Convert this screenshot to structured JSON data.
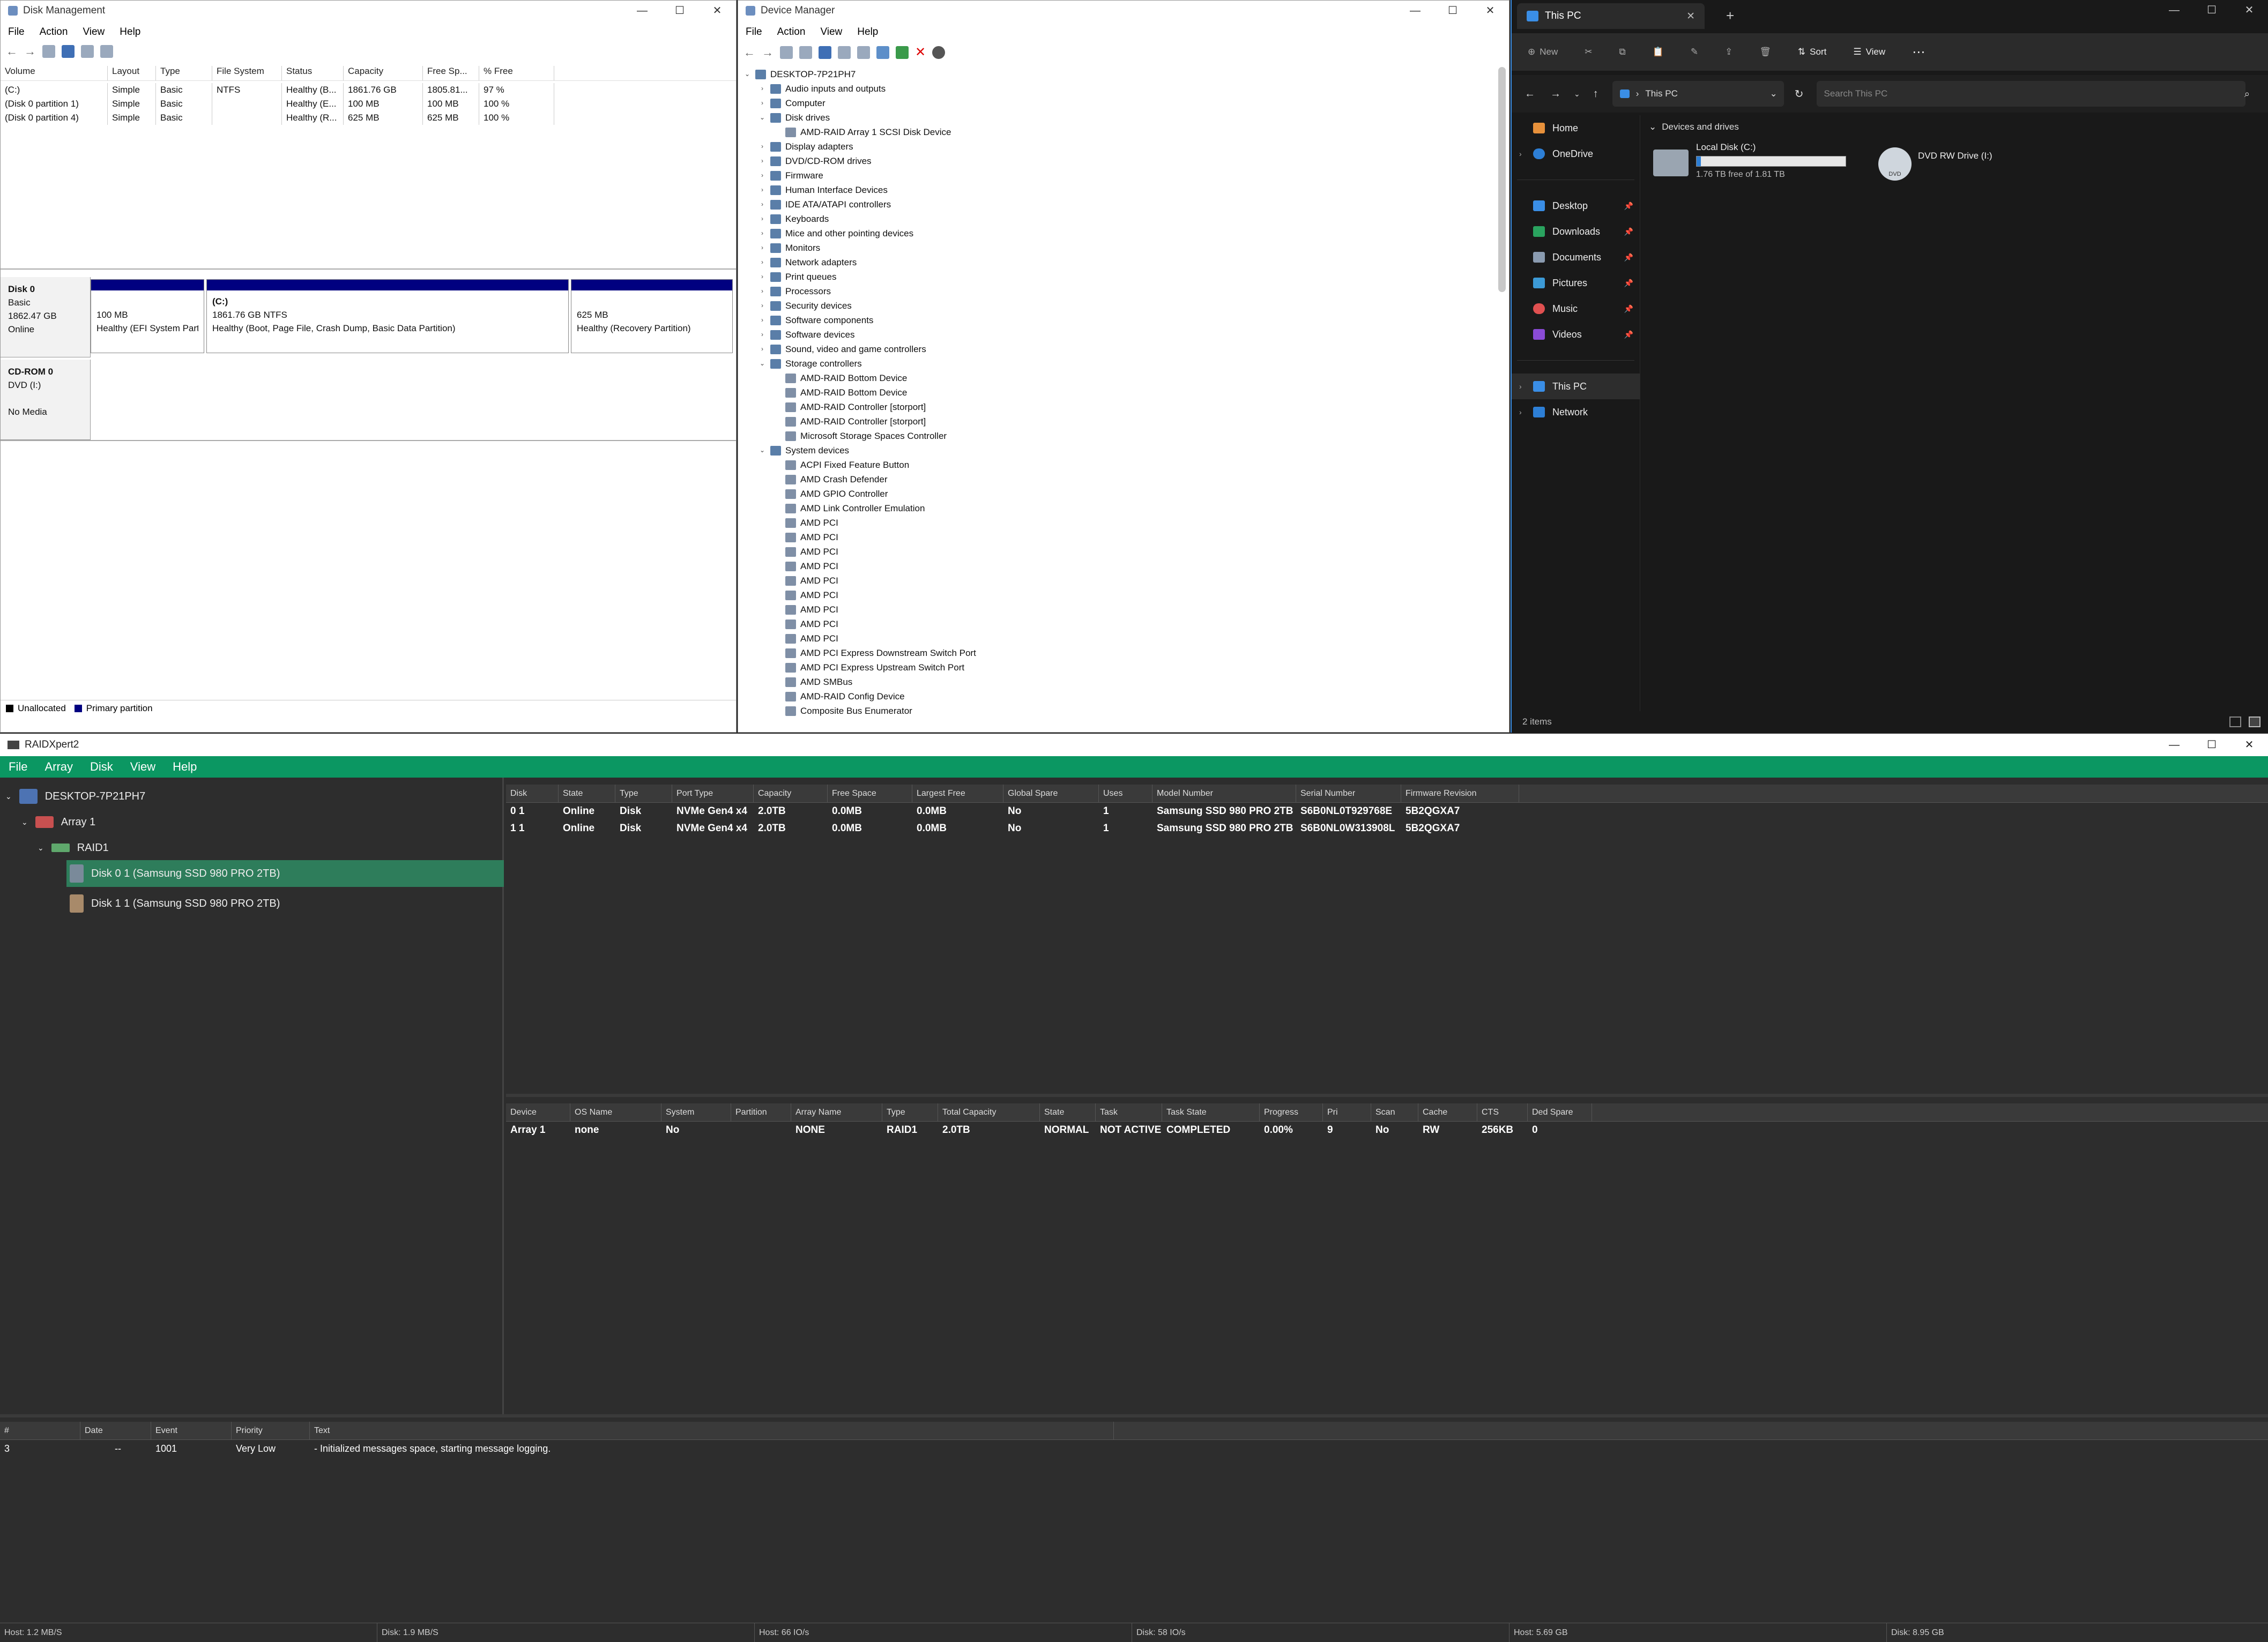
{
  "disk_management": {
    "title": "Disk Management",
    "menu": [
      "File",
      "Action",
      "View",
      "Help"
    ],
    "columns": [
      "Volume",
      "Layout",
      "Type",
      "File System",
      "Status",
      "Capacity",
      "Free Sp...",
      "% Free"
    ],
    "volumes": [
      [
        "(C:)",
        "Simple",
        "Basic",
        "NTFS",
        "Healthy (B...",
        "1861.76 GB",
        "1805.81...",
        "97 %"
      ],
      [
        "(Disk 0 partition 1)",
        "Simple",
        "Basic",
        "",
        "Healthy (E...",
        "100 MB",
        "100 MB",
        "100 %"
      ],
      [
        "(Disk 0 partition 4)",
        "Simple",
        "Basic",
        "",
        "Healthy (R...",
        "625 MB",
        "625 MB",
        "100 %"
      ]
    ],
    "disk0": {
      "name": "Disk 0",
      "type": "Basic",
      "size": "1862.47 GB",
      "state": "Online"
    },
    "partitions": [
      {
        "l1": "",
        "l2": "100 MB",
        "l3": "Healthy (EFI System Part"
      },
      {
        "l1": "(C:)",
        "l2": "1861.76 GB NTFS",
        "l3": "Healthy (Boot, Page File, Crash Dump, Basic Data Partition)"
      },
      {
        "l1": "",
        "l2": "625 MB",
        "l3": "Healthy (Recovery Partition)"
      }
    ],
    "cdrom": {
      "name": "CD-ROM 0",
      "type": "DVD (I:)",
      "state": "No Media"
    },
    "legend": [
      "Unallocated",
      "Primary partition"
    ]
  },
  "device_manager": {
    "title": "Device Manager",
    "menu": [
      "File",
      "Action",
      "View",
      "Help"
    ],
    "nodes": [
      {
        "d": 0,
        "e": "v",
        "t": "DESKTOP-7P21PH7"
      },
      {
        "d": 1,
        "e": ">",
        "t": "Audio inputs and outputs"
      },
      {
        "d": 1,
        "e": ">",
        "t": "Computer"
      },
      {
        "d": 1,
        "e": "v",
        "t": "Disk drives"
      },
      {
        "d": 2,
        "e": "",
        "t": "AMD-RAID Array 1  SCSI Disk Device"
      },
      {
        "d": 1,
        "e": ">",
        "t": "Display adapters"
      },
      {
        "d": 1,
        "e": ">",
        "t": "DVD/CD-ROM drives"
      },
      {
        "d": 1,
        "e": ">",
        "t": "Firmware"
      },
      {
        "d": 1,
        "e": ">",
        "t": "Human Interface Devices"
      },
      {
        "d": 1,
        "e": ">",
        "t": "IDE ATA/ATAPI controllers"
      },
      {
        "d": 1,
        "e": ">",
        "t": "Keyboards"
      },
      {
        "d": 1,
        "e": ">",
        "t": "Mice and other pointing devices"
      },
      {
        "d": 1,
        "e": ">",
        "t": "Monitors"
      },
      {
        "d": 1,
        "e": ">",
        "t": "Network adapters"
      },
      {
        "d": 1,
        "e": ">",
        "t": "Print queues"
      },
      {
        "d": 1,
        "e": ">",
        "t": "Processors"
      },
      {
        "d": 1,
        "e": ">",
        "t": "Security devices"
      },
      {
        "d": 1,
        "e": ">",
        "t": "Software components"
      },
      {
        "d": 1,
        "e": ">",
        "t": "Software devices"
      },
      {
        "d": 1,
        "e": ">",
        "t": "Sound, video and game controllers"
      },
      {
        "d": 1,
        "e": "v",
        "t": "Storage controllers"
      },
      {
        "d": 2,
        "e": "",
        "t": "AMD-RAID Bottom Device"
      },
      {
        "d": 2,
        "e": "",
        "t": "AMD-RAID Bottom Device"
      },
      {
        "d": 2,
        "e": "",
        "t": "AMD-RAID Controller [storport]"
      },
      {
        "d": 2,
        "e": "",
        "t": "AMD-RAID Controller [storport]"
      },
      {
        "d": 2,
        "e": "",
        "t": "Microsoft Storage Spaces Controller"
      },
      {
        "d": 1,
        "e": "v",
        "t": "System devices"
      },
      {
        "d": 2,
        "e": "",
        "t": "ACPI Fixed Feature Button"
      },
      {
        "d": 2,
        "e": "",
        "t": "AMD Crash Defender"
      },
      {
        "d": 2,
        "e": "",
        "t": "AMD GPIO Controller"
      },
      {
        "d": 2,
        "e": "",
        "t": "AMD Link Controller Emulation"
      },
      {
        "d": 2,
        "e": "",
        "t": "AMD PCI"
      },
      {
        "d": 2,
        "e": "",
        "t": "AMD PCI"
      },
      {
        "d": 2,
        "e": "",
        "t": "AMD PCI"
      },
      {
        "d": 2,
        "e": "",
        "t": "AMD PCI"
      },
      {
        "d": 2,
        "e": "",
        "t": "AMD PCI"
      },
      {
        "d": 2,
        "e": "",
        "t": "AMD PCI"
      },
      {
        "d": 2,
        "e": "",
        "t": "AMD PCI"
      },
      {
        "d": 2,
        "e": "",
        "t": "AMD PCI"
      },
      {
        "d": 2,
        "e": "",
        "t": "AMD PCI"
      },
      {
        "d": 2,
        "e": "",
        "t": "AMD PCI Express Downstream Switch Port"
      },
      {
        "d": 2,
        "e": "",
        "t": "AMD PCI Express Upstream Switch Port"
      },
      {
        "d": 2,
        "e": "",
        "t": "AMD SMBus"
      },
      {
        "d": 2,
        "e": "",
        "t": "AMD-RAID Config Device"
      },
      {
        "d": 2,
        "e": "",
        "t": "Composite Bus Enumerator"
      }
    ]
  },
  "explorer": {
    "tab_title": "This PC",
    "new_label": "New",
    "sort_label": "Sort",
    "view_label": "View",
    "address": "This PC",
    "search_placeholder": "Search This PC",
    "nav": [
      "Home",
      "OneDrive",
      "Desktop",
      "Downloads",
      "Documents",
      "Pictures",
      "Music",
      "Videos",
      "This PC",
      "Network"
    ],
    "section": "Devices and drives",
    "drive_c": {
      "name": "Local Disk (C:)",
      "free": "1.76 TB free of 1.81 TB",
      "used_fraction": 0.03
    },
    "drive_dvd": {
      "name": "DVD RW Drive (I:)",
      "badge": "DVD"
    },
    "status": "2 items"
  },
  "raid": {
    "title": "RAIDXpert2",
    "menu": [
      "File",
      "Array",
      "Disk",
      "View",
      "Help"
    ],
    "tree": [
      "DESKTOP-7P21PH7",
      "Array 1",
      "RAID1",
      "Disk 0 1 (Samsung SSD 980 PRO 2TB)",
      "Disk 1 1 (Samsung SSD 980 PRO 2TB)"
    ],
    "disk_cols": [
      "Disk",
      "State",
      "Type",
      "Port Type",
      "Capacity",
      "Free Space",
      "Largest Free",
      "Global Spare",
      "Uses",
      "Model Number",
      "Serial Number",
      "Firmware Revision"
    ],
    "disk_rows": [
      [
        "0 1",
        "Online",
        "Disk",
        "NVMe Gen4 x4",
        "2.0TB",
        "0.0MB",
        "0.0MB",
        "No",
        "1",
        "Samsung SSD 980 PRO 2TB",
        "S6B0NL0T929768E",
        "5B2QGXA7"
      ],
      [
        "1 1",
        "Online",
        "Disk",
        "NVMe Gen4 x4",
        "2.0TB",
        "0.0MB",
        "0.0MB",
        "No",
        "1",
        "Samsung SSD 980 PRO 2TB",
        "S6B0NL0W313908L",
        "5B2QGXA7"
      ]
    ],
    "array_cols": [
      "Device",
      "OS Name",
      "System",
      "Partition",
      "Array Name",
      "Type",
      "Total Capacity",
      "State",
      "Task",
      "Task State",
      "Progress",
      "Pri",
      "Scan",
      "Cache",
      "CTS",
      "Ded Spare"
    ],
    "array_rows": [
      [
        "Array 1",
        "none",
        "No",
        "",
        "NONE",
        "RAID1",
        "2.0TB",
        "NORMAL",
        "NOT ACTIVE",
        "COMPLETED",
        "0.00%",
        "9",
        "No",
        "RW",
        "256KB",
        "0"
      ]
    ],
    "log_cols": [
      "#",
      "Date",
      "Event",
      "Priority",
      "Text"
    ],
    "log_rows": [
      [
        "3",
        "--",
        "1001",
        "Very Low",
        "- Initialized messages space, starting message logging."
      ]
    ],
    "status": [
      "Host: 1.2 MB/S",
      "Disk: 1.9 MB/S",
      "Host: 66 IO/s",
      "Disk: 58 IO/s",
      "Host: 5.69 GB",
      "Disk: 8.95 GB"
    ]
  }
}
